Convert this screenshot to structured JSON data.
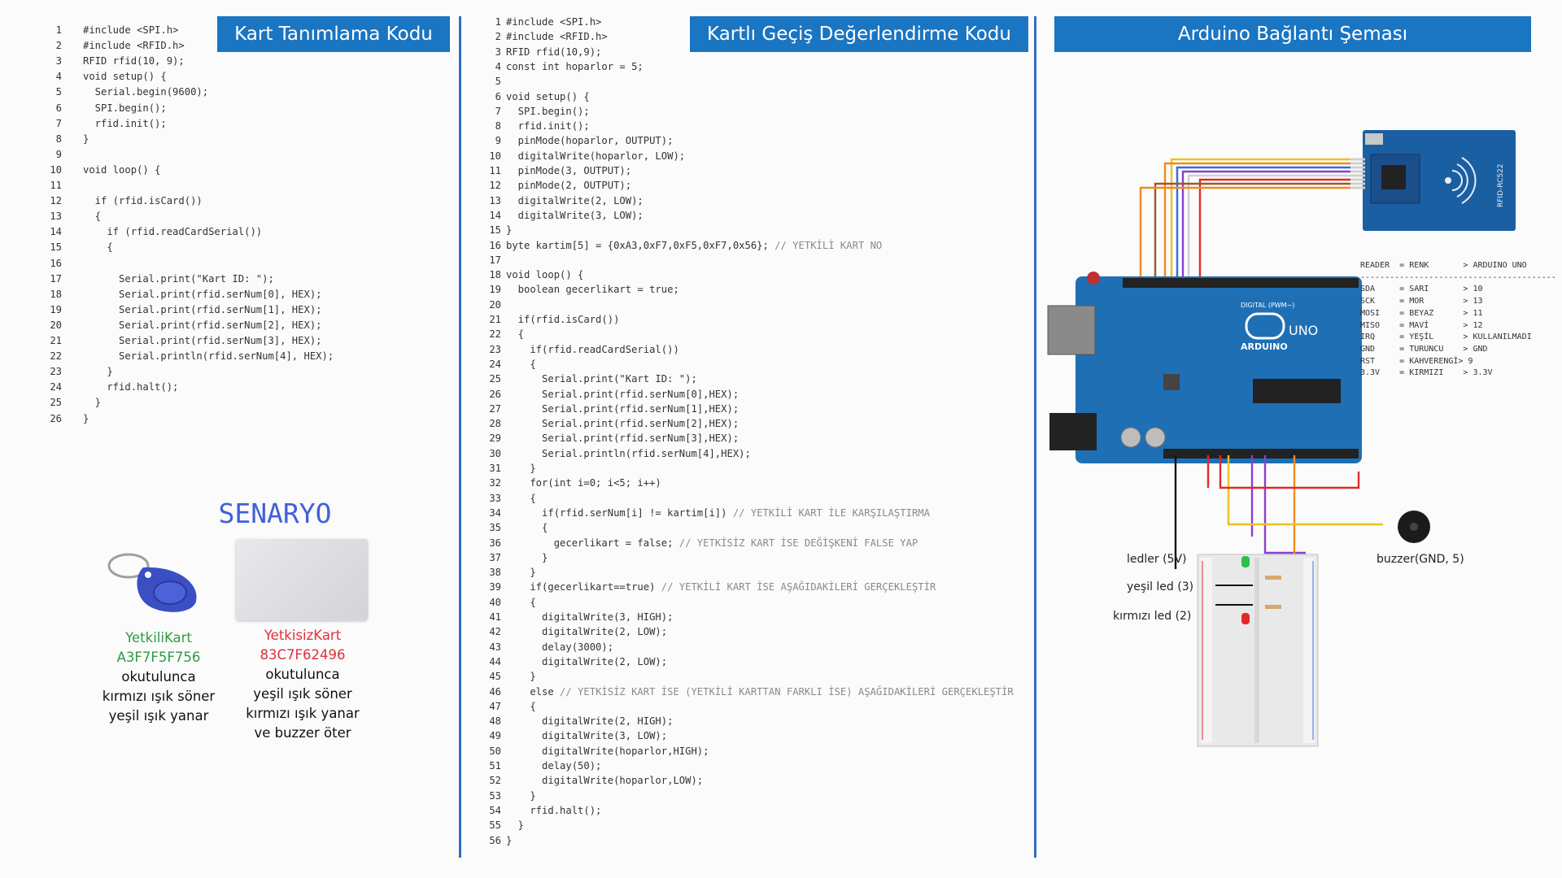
{
  "panels": {
    "left_banner": "Kart Tanımlama Kodu",
    "middle_banner": "Kartlı Geçiş Değerlendirme Kodu",
    "right_banner": "Arduino Bağlantı Şeması"
  },
  "code1": [
    {
      "n": "1",
      "t": "#include <SPI.h>"
    },
    {
      "n": "2",
      "t": "#include <RFID.h>"
    },
    {
      "n": "3",
      "t": "RFID rfid(10, 9);"
    },
    {
      "n": "4",
      "t": "void setup() {"
    },
    {
      "n": "5",
      "t": "  Serial.begin(9600);"
    },
    {
      "n": "6",
      "t": "  SPI.begin();"
    },
    {
      "n": "7",
      "t": "  rfid.init();"
    },
    {
      "n": "8",
      "t": "}"
    },
    {
      "n": "9",
      "t": ""
    },
    {
      "n": "10",
      "t": "void loop() {"
    },
    {
      "n": "11",
      "t": ""
    },
    {
      "n": "12",
      "t": "  if (rfid.isCard())"
    },
    {
      "n": "13",
      "t": "  {"
    },
    {
      "n": "14",
      "t": "    if (rfid.readCardSerial())"
    },
    {
      "n": "15",
      "t": "    {"
    },
    {
      "n": "16",
      "t": ""
    },
    {
      "n": "17",
      "t": "      Serial.print(\"Kart ID: \");"
    },
    {
      "n": "18",
      "t": "      Serial.print(rfid.serNum[0], HEX);"
    },
    {
      "n": "19",
      "t": "      Serial.print(rfid.serNum[1], HEX);"
    },
    {
      "n": "20",
      "t": "      Serial.print(rfid.serNum[2], HEX);"
    },
    {
      "n": "21",
      "t": "      Serial.print(rfid.serNum[3], HEX);"
    },
    {
      "n": "22",
      "t": "      Serial.println(rfid.serNum[4], HEX);"
    },
    {
      "n": "23",
      "t": "    }"
    },
    {
      "n": "24",
      "t": "    rfid.halt();"
    },
    {
      "n": "25",
      "t": "  }"
    },
    {
      "n": "26",
      "t": "}"
    }
  ],
  "code2": [
    {
      "n": "1",
      "t": "#include <SPI.h>"
    },
    {
      "n": "2",
      "t": "#include <RFID.h>"
    },
    {
      "n": "3",
      "t": "RFID rfid(10,9);"
    },
    {
      "n": "4",
      "t": "const int hoparlor = 5;"
    },
    {
      "n": "5",
      "t": ""
    },
    {
      "n": "6",
      "t": "void setup() {"
    },
    {
      "n": "7",
      "t": "  SPI.begin();"
    },
    {
      "n": "8",
      "t": "  rfid.init();"
    },
    {
      "n": "9",
      "t": "  pinMode(hoparlor, OUTPUT);"
    },
    {
      "n": "10",
      "t": "  digitalWrite(hoparlor, LOW);"
    },
    {
      "n": "11",
      "t": "  pinMode(3, OUTPUT);"
    },
    {
      "n": "12",
      "t": "  pinMode(2, OUTPUT);"
    },
    {
      "n": "13",
      "t": "  digitalWrite(2, LOW);"
    },
    {
      "n": "14",
      "t": "  digitalWrite(3, LOW);"
    },
    {
      "n": "15",
      "t": "}"
    },
    {
      "n": "16",
      "t": "byte kartim[5] = {0xA3,0xF7,0xF5,0xF7,0x56}; // YETKİLİ KART NO"
    },
    {
      "n": "17",
      "t": ""
    },
    {
      "n": "18",
      "t": "void loop() {"
    },
    {
      "n": "19",
      "t": "  boolean gecerlikart = true;"
    },
    {
      "n": "20",
      "t": ""
    },
    {
      "n": "21",
      "t": "  if(rfid.isCard())"
    },
    {
      "n": "22",
      "t": "  {"
    },
    {
      "n": "23",
      "t": "    if(rfid.readCardSerial())"
    },
    {
      "n": "24",
      "t": "    {"
    },
    {
      "n": "25",
      "t": "      Serial.print(\"Kart ID: \");"
    },
    {
      "n": "26",
      "t": "      Serial.print(rfid.serNum[0],HEX);"
    },
    {
      "n": "27",
      "t": "      Serial.print(rfid.serNum[1],HEX);"
    },
    {
      "n": "28",
      "t": "      Serial.print(rfid.serNum[2],HEX);"
    },
    {
      "n": "29",
      "t": "      Serial.print(rfid.serNum[3],HEX);"
    },
    {
      "n": "30",
      "t": "      Serial.println(rfid.serNum[4],HEX);"
    },
    {
      "n": "31",
      "t": "    }"
    },
    {
      "n": "32",
      "t": "    for(int i=0; i<5; i++)"
    },
    {
      "n": "33",
      "t": "    {"
    },
    {
      "n": "34",
      "t": "      if(rfid.serNum[i] != kartim[i]) // YETKİLİ KART İLE KARŞILAŞTIRMA"
    },
    {
      "n": "35",
      "t": "      {"
    },
    {
      "n": "36",
      "t": "        gecerlikart = false; // YETKİSİZ KART İSE DEĞİŞKENİ FALSE YAP"
    },
    {
      "n": "37",
      "t": "      }"
    },
    {
      "n": "38",
      "t": "    }"
    },
    {
      "n": "39",
      "t": "    if(gecerlikart==true) // YETKİLİ KART İSE AŞAĞIDAKİLERİ GERÇEKLEŞTİR"
    },
    {
      "n": "40",
      "t": "    {"
    },
    {
      "n": "41",
      "t": "      digitalWrite(3, HIGH);"
    },
    {
      "n": "42",
      "t": "      digitalWrite(2, LOW);"
    },
    {
      "n": "43",
      "t": "      delay(3000);"
    },
    {
      "n": "44",
      "t": "      digitalWrite(2, LOW);"
    },
    {
      "n": "45",
      "t": "    }"
    },
    {
      "n": "46",
      "t": "    else // YETKİSİZ KART İSE (YETKİLİ KARTTAN FARKLI İSE) AŞAĞIDAKİLERİ GERÇEKLEŞTİR"
    },
    {
      "n": "47",
      "t": "    {"
    },
    {
      "n": "48",
      "t": "      digitalWrite(2, HIGH);"
    },
    {
      "n": "49",
      "t": "      digitalWrite(3, LOW);"
    },
    {
      "n": "50",
      "t": "      digitalWrite(hoparlor,HIGH);"
    },
    {
      "n": "51",
      "t": "      delay(50);"
    },
    {
      "n": "52",
      "t": "      digitalWrite(hoparlor,LOW);"
    },
    {
      "n": "53",
      "t": "    }"
    },
    {
      "n": "54",
      "t": "    rfid.halt();"
    },
    {
      "n": "55",
      "t": "  }"
    },
    {
      "n": "56",
      "t": "}"
    }
  ],
  "scenario": {
    "title": "SENARYO",
    "authorized": {
      "name": "YetkiliKart",
      "id": "A3F7F5F756",
      "l1": "okutulunca",
      "l2": "kırmızı ışık söner",
      "l3": "yeşil ışık yanar"
    },
    "unauthorized": {
      "name": "YetkisizKart",
      "id": "83C7F62496",
      "l1": "okutulunca",
      "l2": "yeşil ışık söner",
      "l3": "kırmızı ışık yanar",
      "l4": "ve buzzer öter"
    }
  },
  "pin_table": [
    "READER  = RENK       > ARDUINO UNO",
    "----------------------------------------",
    "SDA     = SARI       > 10",
    "SCK     = MOR        > 13",
    "MOSI    = BEYAZ      > 11",
    "MISO    = MAVİ       > 12",
    "IRQ     = YEŞİL      > KULLANILMADI",
    "GND     = TURUNCU    > GND",
    "RST     = KAHVERENGİ> 9",
    "3.3V    = KIRMIZI    > 3.3V"
  ],
  "labels": {
    "leds": "ledler (5V)",
    "green_led": "yeşil led (3)",
    "red_led": "kırmızı  led (2)",
    "buzzer": "buzzer(GND, 5)",
    "rfid_module": "RFID-RC522",
    "arduino": "ARDUINO",
    "uno": "UNO",
    "digital": "DIGITAL (PWM~)"
  },
  "colors": {
    "banner": "#1a75c2",
    "divider": "#2f6fc0",
    "board": "#1f6fb5",
    "rfid": "#1b5fa3",
    "wire_yellow": "#f0c020",
    "wire_purple": "#8a3fd0",
    "wire_white": "#dddddd",
    "wire_blue": "#2f6fe0",
    "wire_orange": "#f28a1e",
    "wire_red": "#e02a2a",
    "wire_black": "#111111"
  }
}
